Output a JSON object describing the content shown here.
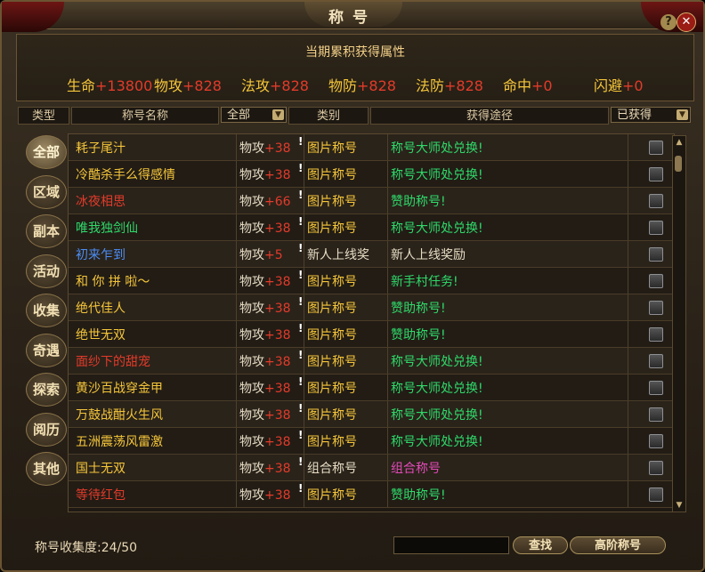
{
  "window": {
    "title": "称号",
    "help_label": "?",
    "close_label": "✕"
  },
  "stats": {
    "heading": "当期累积获得属性",
    "items": [
      {
        "label": "生命",
        "value": "+13800"
      },
      {
        "label": "物攻",
        "value": "+828"
      },
      {
        "label": "法攻",
        "value": "+828"
      },
      {
        "label": "物防",
        "value": "+828"
      },
      {
        "label": "法防",
        "value": "+828"
      },
      {
        "label": "命中",
        "value": "+0"
      },
      {
        "label": "闪避",
        "value": "+0"
      }
    ]
  },
  "headers": {
    "type": "类型",
    "name": "称号名称",
    "name_filter": "全部",
    "category": "类别",
    "source": "获得途径",
    "obtained_filter": "已获得"
  },
  "sidebar": [
    "全部",
    "区域",
    "副本",
    "活动",
    "收集",
    "奇遇",
    "探索",
    "阅历",
    "其他"
  ],
  "colors": {
    "gold": "#f5c63a",
    "red": "#e23b2a",
    "green": "#2fd96a",
    "blue": "#4b8ef5",
    "pink": "#e24ab8",
    "white": "#e6dcc4"
  },
  "rows": [
    {
      "name": "耗子尾汁",
      "name_color": "#f5c63a",
      "attr": "物攻",
      "val": "+38",
      "cat": "图片称号",
      "cat_color": "#f5c63a",
      "src": "称号大师处兑换!",
      "src_color": "#2fd96a"
    },
    {
      "name": "冷酷杀手么得感情",
      "name_color": "#f5c63a",
      "attr": "物攻",
      "val": "+38",
      "cat": "图片称号",
      "cat_color": "#f5c63a",
      "src": "称号大师处兑换!",
      "src_color": "#2fd96a"
    },
    {
      "name": "冰夜相思",
      "name_color": "#e23b2a",
      "attr": "物攻",
      "val": "+66",
      "cat": "图片称号",
      "cat_color": "#f5c63a",
      "src": "赞助称号!",
      "src_color": "#2fd96a"
    },
    {
      "name": "唯我独剑仙",
      "name_color": "#2fd96a",
      "attr": "物攻",
      "val": "+38",
      "cat": "图片称号",
      "cat_color": "#f5c63a",
      "src": "称号大师处兑换!",
      "src_color": "#2fd96a"
    },
    {
      "name": "初来乍到",
      "name_color": "#4b8ef5",
      "attr": "物攻",
      "val": "+5",
      "cat": "新人上线奖",
      "cat_color": "#e6dcc4",
      "src": "新人上线奖励",
      "src_color": "#e6dcc4"
    },
    {
      "name": "和 你 拼 啦～",
      "name_color": "#f5c63a",
      "attr": "物攻",
      "val": "+38",
      "cat": "图片称号",
      "cat_color": "#f5c63a",
      "src": "新手村任务!",
      "src_color": "#2fd96a"
    },
    {
      "name": "绝代佳人",
      "name_color": "#f5c63a",
      "attr": "物攻",
      "val": "+38",
      "cat": "图片称号",
      "cat_color": "#f5c63a",
      "src": "赞助称号!",
      "src_color": "#2fd96a"
    },
    {
      "name": "绝世无双",
      "name_color": "#f5c63a",
      "attr": "物攻",
      "val": "+38",
      "cat": "图片称号",
      "cat_color": "#f5c63a",
      "src": "赞助称号!",
      "src_color": "#2fd96a"
    },
    {
      "name": "面纱下的甜宠",
      "name_color": "#e23b2a",
      "attr": "物攻",
      "val": "+38",
      "cat": "图片称号",
      "cat_color": "#f5c63a",
      "src": "称号大师处兑换!",
      "src_color": "#2fd96a"
    },
    {
      "name": "黄沙百战穿金甲",
      "name_color": "#f5c63a",
      "attr": "物攻",
      "val": "+38",
      "cat": "图片称号",
      "cat_color": "#f5c63a",
      "src": "称号大师处兑换!",
      "src_color": "#2fd96a"
    },
    {
      "name": "万鼓战酣火生风",
      "name_color": "#f5c63a",
      "attr": "物攻",
      "val": "+38",
      "cat": "图片称号",
      "cat_color": "#f5c63a",
      "src": "称号大师处兑换!",
      "src_color": "#2fd96a"
    },
    {
      "name": "五洲震荡风雷激",
      "name_color": "#f5c63a",
      "attr": "物攻",
      "val": "+38",
      "cat": "图片称号",
      "cat_color": "#f5c63a",
      "src": "称号大师处兑换!",
      "src_color": "#2fd96a"
    },
    {
      "name": "国士无双",
      "name_color": "#f5c63a",
      "attr": "物攻",
      "val": "+38",
      "cat": "组合称号",
      "cat_color": "#e6dcc4",
      "src": "组合称号",
      "src_color": "#e24ab8"
    },
    {
      "name": "等待红包",
      "name_color": "#e23b2a",
      "attr": "物攻",
      "val": "+38",
      "cat": "图片称号",
      "cat_color": "#f5c63a",
      "src": "赞助称号!",
      "src_color": "#2fd96a"
    }
  ],
  "footer": {
    "collection": "称号收集度:24/50",
    "search_button": "查找",
    "advanced_button": "高阶称号"
  }
}
